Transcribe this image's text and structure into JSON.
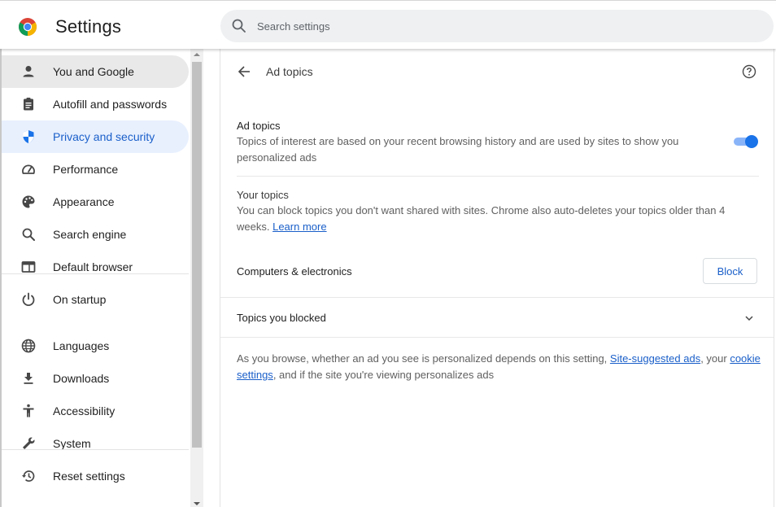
{
  "header": {
    "app_title": "Settings",
    "search_placeholder": "Search settings",
    "search_value": ""
  },
  "sidebar": {
    "items": [
      {
        "label": "You and Google",
        "icon": "person-icon",
        "state": "hover"
      },
      {
        "label": "Autofill and passwords",
        "icon": "clipboard-icon",
        "state": ""
      },
      {
        "label": "Privacy and security",
        "icon": "shield-icon",
        "state": "active"
      },
      {
        "label": "Performance",
        "icon": "speedometer-icon",
        "state": ""
      },
      {
        "label": "Appearance",
        "icon": "palette-icon",
        "state": ""
      },
      {
        "label": "Search engine",
        "icon": "search-icon",
        "state": ""
      },
      {
        "label": "Default browser",
        "icon": "browser-window-icon",
        "state": ""
      },
      {
        "label": "On startup",
        "icon": "power-icon",
        "state": ""
      },
      {
        "label": "Languages",
        "icon": "globe-icon",
        "state": ""
      },
      {
        "label": "Downloads",
        "icon": "download-icon",
        "state": ""
      },
      {
        "label": "Accessibility",
        "icon": "accessibility-icon",
        "state": ""
      },
      {
        "label": "System",
        "icon": "wrench-icon",
        "state": ""
      },
      {
        "label": "Reset settings",
        "icon": "history-icon",
        "state": ""
      }
    ]
  },
  "main": {
    "page_title": "Ad topics",
    "ad_topics": {
      "title": "Ad topics",
      "description": "Topics of interest are based on your recent browsing history and are used by sites to show you personalized ads",
      "enabled": true
    },
    "your_topics": {
      "title": "Your topics",
      "description": "You can block topics you don't want shared with sites. Chrome also auto-deletes your topics older than 4 weeks.",
      "learn_more": "Learn more"
    },
    "topics": [
      {
        "name": "Computers & electronics",
        "action": "Block"
      }
    ],
    "blocked": {
      "label": "Topics you blocked",
      "expanded": false
    },
    "footer": {
      "text_1": "As you browse, whether an ad you see is personalized depends on this setting, ",
      "link_1": "Site-suggested ads",
      "text_2": ", your ",
      "link_2": "cookie settings",
      "text_3": ", and if the site you're viewing personalizes ads"
    }
  },
  "colors": {
    "accent": "#1a73e8",
    "accent_text": "#1a5fc9",
    "active_nav_bg": "#e8f0fe",
    "toggle_track": "#8ab4f8"
  }
}
